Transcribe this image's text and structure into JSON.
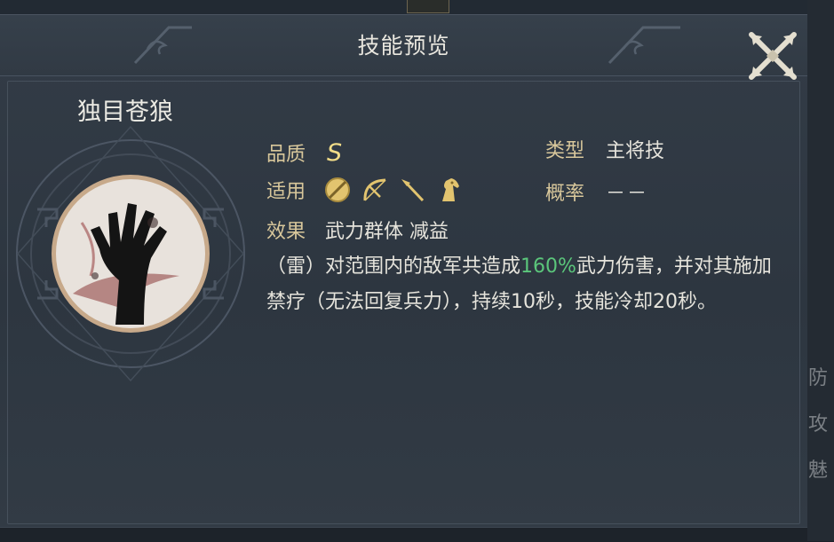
{
  "window": {
    "title": "技能预览"
  },
  "skill": {
    "name": "独目苍狼",
    "quality_label": "品质",
    "quality_value": "S",
    "type_label": "类型",
    "type_value": "主将技",
    "apply_label": "适用",
    "apply_icons": [
      "shield-icon",
      "bow-icon",
      "spear-icon",
      "horse-icon"
    ],
    "chance_label": "概率",
    "chance_value": "－－",
    "effect_label": "效果",
    "effect_value": "武力群体 减益",
    "description": {
      "part1": "（雷）对范围内的敌军共造成",
      "highlight": "160%",
      "part2": "武力伤害，并对其施加禁疗（无法回复兵力），持续10秒，技能冷却20秒。"
    }
  },
  "background": {
    "side_chars": [
      "防",
      "攻",
      "魅"
    ]
  },
  "colors": {
    "label": "#d8c79b",
    "grade": "#f2dd88",
    "highlight": "#5bc67b",
    "text": "#e6e4dc"
  }
}
